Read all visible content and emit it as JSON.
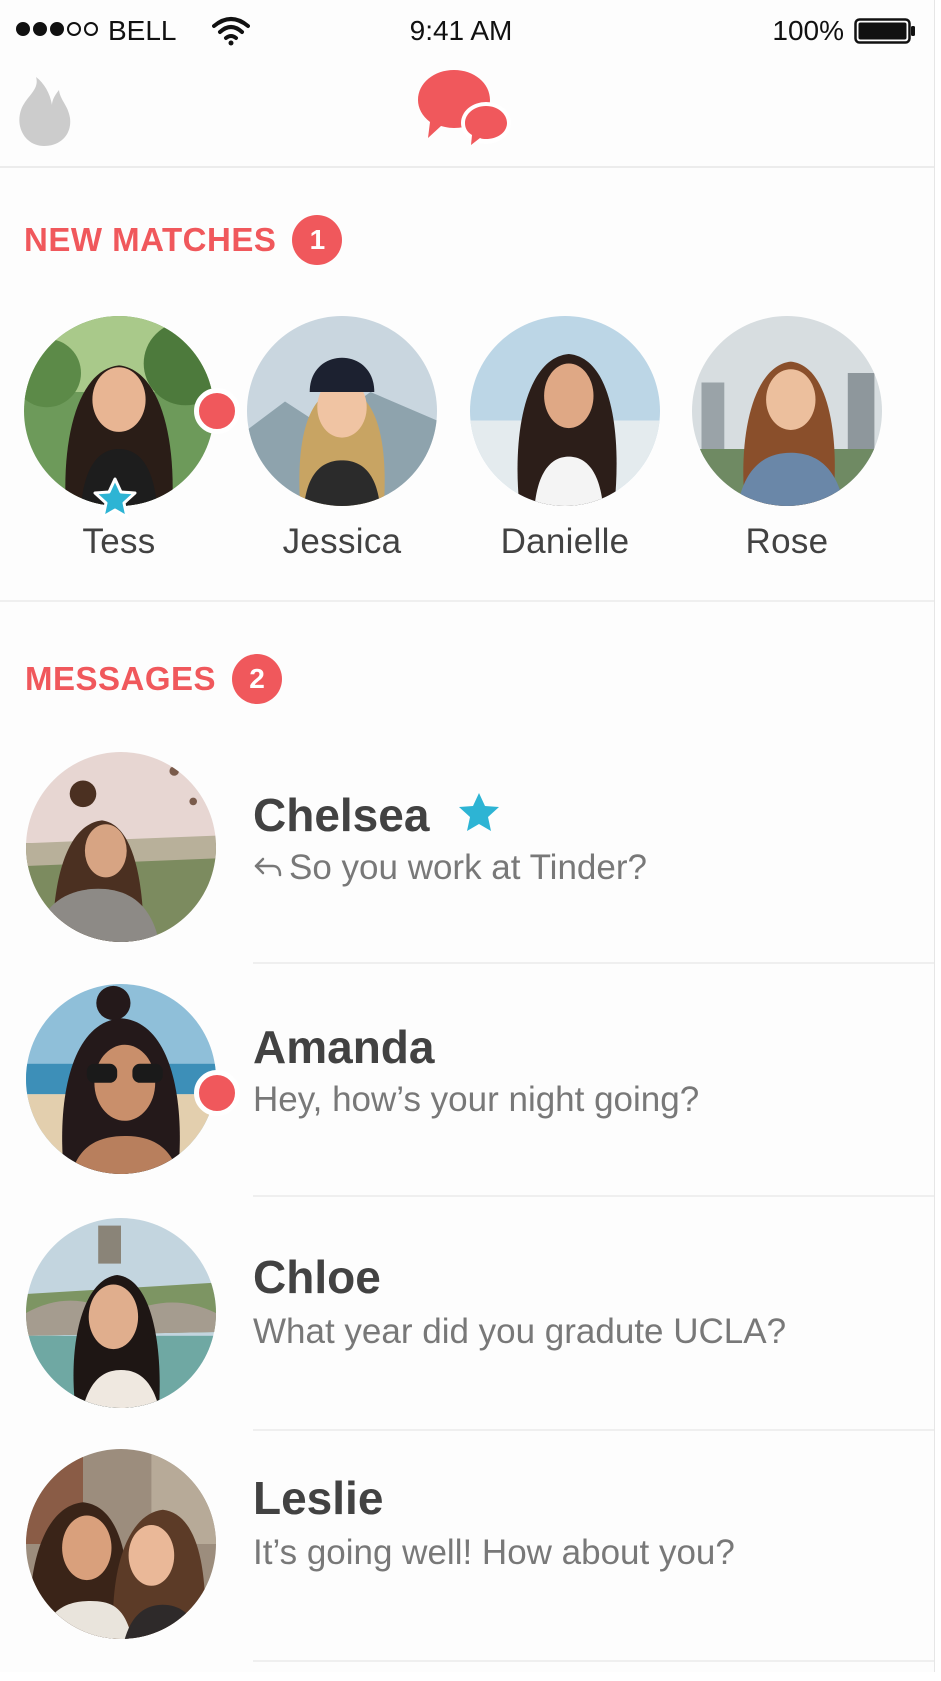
{
  "status_bar": {
    "carrier": "BELL",
    "time": "9:41 AM",
    "battery": "100%"
  },
  "colors": {
    "brand": "#f0585c",
    "super_like": "#2db4d4"
  },
  "new_matches": {
    "title": "NEW MATCHES",
    "count": "1",
    "items": [
      {
        "name": "Tess"
      },
      {
        "name": "Jessica"
      },
      {
        "name": "Danielle"
      },
      {
        "name": "Rose"
      }
    ]
  },
  "messages": {
    "title": "MESSAGES",
    "count": "2",
    "items": [
      {
        "name": "Chelsea",
        "preview": "So you work at Tinder?"
      },
      {
        "name": "Amanda",
        "preview": "Hey, how’s your night going?"
      },
      {
        "name": "Chloe",
        "preview": "What year did you gradute UCLA?"
      },
      {
        "name": "Leslie",
        "preview": "It’s going well! How about you?"
      }
    ]
  }
}
